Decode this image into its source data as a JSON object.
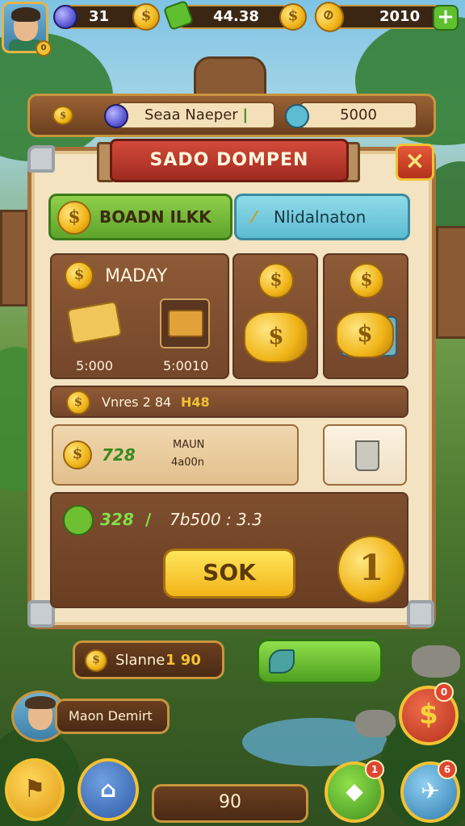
{
  "colors": {
    "accent": "#f2c233",
    "panel": "#f3e3c1",
    "wood": "#8e5a36",
    "ribbon": "#c63d2f",
    "green": "#6fbf33",
    "blue": "#5cbcd1"
  },
  "top_bar": {
    "avatar_level": "0",
    "gems": "31",
    "cash": "44.38",
    "gold": "2010"
  },
  "info_bar": {
    "name": "Seaa Naeper",
    "mark": "|",
    "value": "5000"
  },
  "panel": {
    "title": "SADO DOMPEN",
    "close": "×",
    "tabs": [
      {
        "label": "BOADN ILKK",
        "icon": "coin-icon"
      },
      {
        "label": "Nlidalnaton",
        "icon": "ticket-icon"
      }
    ],
    "offers": [
      {
        "heading": "MADAY",
        "items": [
          {
            "icon": "scroll-icon",
            "price": "5:000"
          },
          {
            "icon": "crate-icon",
            "price": "5:0010"
          }
        ]
      },
      {
        "icon": "coin-pile-icon"
      },
      {
        "icon": "coin-stack-icon"
      }
    ],
    "row1": {
      "text": "Vnres 2 84",
      "highlight": "H48"
    },
    "row2": {
      "value": "728",
      "caption_line1": "MAUN",
      "caption_line2": "4a00n"
    },
    "row3": {
      "value": "328",
      "separator": "/",
      "extra": "7b500 : 3.3"
    },
    "ok_button": "SOK",
    "big_coin": "1"
  },
  "bottom": {
    "status_label": "Slanne",
    "status_value": "1 90",
    "player_name": "Maon Demirt",
    "counter": "90",
    "badges": {
      "shop": "0",
      "gift": "1",
      "map": "6"
    }
  }
}
